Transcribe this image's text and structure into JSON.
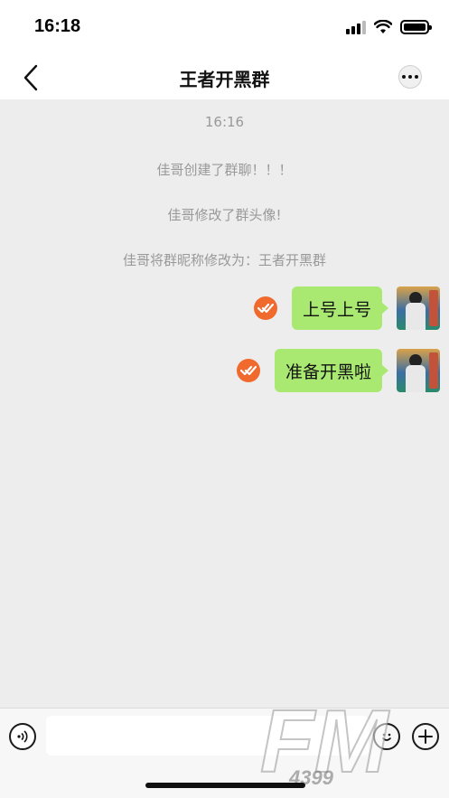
{
  "status_bar": {
    "time": "16:18"
  },
  "nav": {
    "title": "王者开黑群"
  },
  "chat": {
    "system_messages": [
      {
        "text": "16:16"
      },
      {
        "text": "佳哥创建了群聊！！！"
      },
      {
        "text": "佳哥修改了群头像!"
      },
      {
        "text": "佳哥将群昵称修改为：王者开黑群"
      }
    ],
    "messages": [
      {
        "text": "上号上号",
        "sender": "self"
      },
      {
        "text": "准备开黑啦",
        "sender": "self"
      }
    ]
  },
  "input": {
    "value": "",
    "placeholder": ""
  },
  "watermark": {
    "text": "FM",
    "sub": "4399"
  },
  "colors": {
    "bubble": "#a9e972",
    "check": "#f06a2d",
    "background": "#ededed"
  }
}
